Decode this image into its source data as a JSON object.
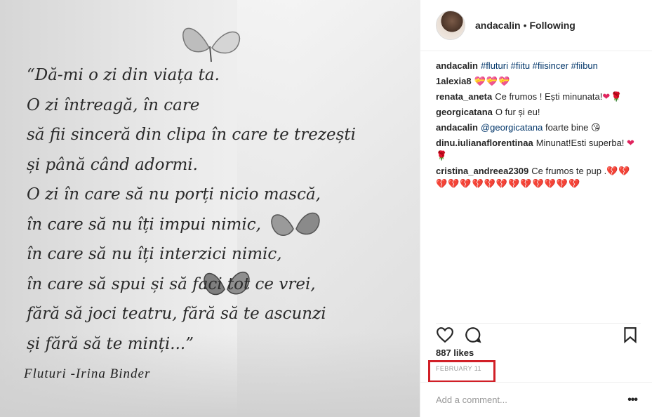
{
  "poem": {
    "lines": [
      "“Dă-mi o zi din viața ta.",
      "O zi întreagă, în care",
      "să fii sinceră din clipa în care te trezești",
      "și până când adormi.",
      "O zi în care să nu porți nicio mască,",
      "în care să nu îți impui nimic,",
      "în care să nu îți interzici nimic,",
      "în care să spui și să faci tot ce vrei,",
      "fără să joci teatru, fără să te ascunzi",
      "și fără să te minți...”"
    ],
    "signature": "Fluturi -Irina Binder"
  },
  "header": {
    "username": "andacalin",
    "separator": "•",
    "follow_status": "Following"
  },
  "comments": [
    {
      "user": "andacalin",
      "text": "",
      "tags": "#fluturi #fiitu #fiisincer #fiibun",
      "emoji": ""
    },
    {
      "user": "1alexia8",
      "text": "",
      "tags": "",
      "emoji": "💝💝💝"
    },
    {
      "user": "renata_aneta",
      "text": "Ce frumos ! Ești minunata!",
      "tags": "",
      "emoji": "❤🌹"
    },
    {
      "user": "georgicatana",
      "text": "O fur și eu!",
      "tags": "",
      "emoji": ""
    },
    {
      "user": "andacalin",
      "text": " foarte bine",
      "tags": "@georgicatana",
      "emoji": "😘"
    },
    {
      "user": "dinu.iulianaflorentinaa",
      "text": "Minunat!Esti superba!",
      "tags": "",
      "emoji": "❤🌹"
    },
    {
      "user": "cristina_andreea2309",
      "text": "Ce frumos te pup .",
      "tags": "",
      "emoji": "💔💔💔💔💔💔💔💔💔💔💔💔💔💔"
    }
  ],
  "actions": {
    "like_icon": "heart-icon",
    "comment_icon": "speech-bubble-icon",
    "save_icon": "bookmark-icon"
  },
  "likes": "887 likes",
  "date": "FEBRUARY 11",
  "add_comment": {
    "placeholder": "Add a comment...",
    "more_label": "•••"
  },
  "colors": {
    "highlight_box": "#d11f27",
    "link": "#003569",
    "text": "#262626",
    "muted": "#999999"
  }
}
